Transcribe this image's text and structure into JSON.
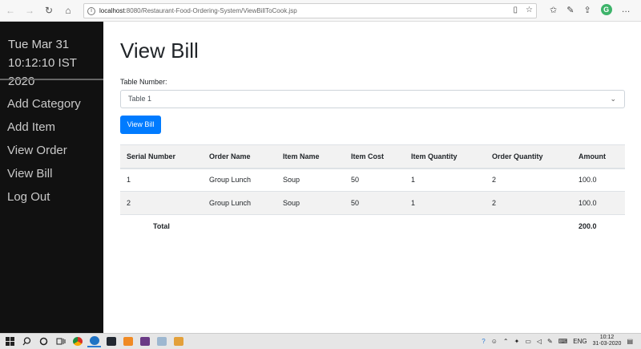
{
  "browser": {
    "url_host": "localhost",
    "url_path": ":8080/Restaurant-Food-Ordering-System/ViewBillToCook.jsp",
    "back_glyph": "←",
    "forward_glyph": "→",
    "refresh_glyph": "↻",
    "home_glyph": "⌂",
    "reader_glyph": "▯",
    "favorite_glyph": "☆",
    "favorites_glyph": "✩",
    "pen_glyph": "✎",
    "share_glyph": "⇪",
    "profile_letter": "G",
    "more_glyph": "…"
  },
  "sidebar": {
    "date": "Tue Mar 31",
    "time": "10:12:10 IST 2020",
    "items": [
      {
        "label": "Add Category"
      },
      {
        "label": "Add Item"
      },
      {
        "label": "View Order"
      },
      {
        "label": "View Bill"
      },
      {
        "label": "Log Out"
      }
    ]
  },
  "main": {
    "title": "View Bill",
    "table_label": "Table Number:",
    "selected_table": "Table 1",
    "chevron_glyph": "⌄",
    "button_label": "View Bill",
    "columns": [
      "Serial Number",
      "Order Name",
      "Item Name",
      "Item Cost",
      "Item Quantity",
      "Order Quantity",
      "Amount"
    ],
    "rows": [
      [
        "1",
        "Group Lunch",
        "Soup",
        "50",
        "1",
        "2",
        "100.0"
      ],
      [
        "2",
        "Group Lunch",
        "Soup",
        "50",
        "1",
        "2",
        "100.0"
      ]
    ],
    "total_label": "Total",
    "total_amount": "200.0"
  },
  "taskbar": {
    "lang": "ENG",
    "time": "10:12",
    "date": "31-03-2020",
    "app_colors": [
      "#3c8dde",
      "#1f73c4",
      "#222831",
      "#f08a24",
      "#6a3a85",
      "#7a7a7a",
      "#e3a03a"
    ]
  }
}
